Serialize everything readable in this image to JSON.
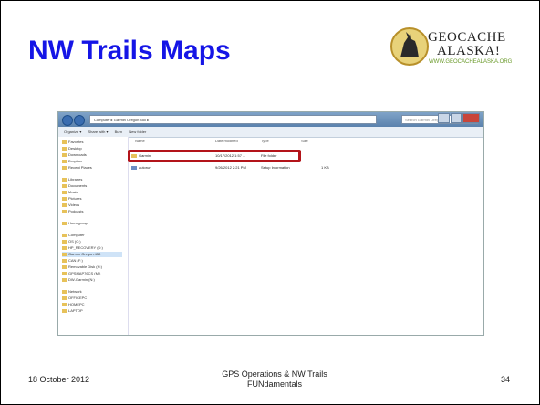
{
  "slide": {
    "title": "NW Trails Maps",
    "logo_text": "GEOCACHE ALASKA! WWW.GEOCACHEALASKA.ORG",
    "footer_date": "18 October 2012",
    "footer_line1": "GPS Operations & NW Trails",
    "footer_line2": "FUNdamentals",
    "page_number": "34"
  },
  "logo": {
    "line1": "GEOCACHE",
    "line2": "ALASKA!",
    "url": "WWW.GEOCACHEALASKA.ORG"
  },
  "explorer": {
    "address": "Computer ▸ Garmin Oregon 450 ▸",
    "search_placeholder": "Search Garmin Oregon 450",
    "toolbar": [
      "Organize ▾",
      "Share with ▾",
      "Burn",
      "New folder"
    ],
    "columns": [
      "Name",
      "Date modified",
      "Type",
      "Size"
    ],
    "files": [
      {
        "name": "Garmin",
        "date": "10/17/2012 1:57 ...",
        "type": "File folder",
        "size": ""
      },
      {
        "name": "autorun",
        "date": "9/26/2012 2:21 PM",
        "type": "Setup Information",
        "size": "1 KB"
      }
    ],
    "sidebar": [
      "Favorites",
      "Desktop",
      "Downloads",
      "Dropbox",
      "Recent Places",
      "Libraries",
      "Documents",
      "Music",
      "Pictures",
      "Videos",
      "Podcasts",
      "Homegroup",
      "Computer",
      "OS (C:)",
      "HP_RECOVERY (D:)",
      "Garmin Oregon 450",
      "CAN (F:)",
      "Removable Disk (H:)",
      "GPSMAP76CS (M:)",
      "DW-Garmin (N:)",
      "Network",
      "OFFICEPC",
      "HOMEPC",
      "LAPTOP"
    ]
  },
  "colors": {
    "title": "#1515e6",
    "highlight": "#b3141a"
  }
}
